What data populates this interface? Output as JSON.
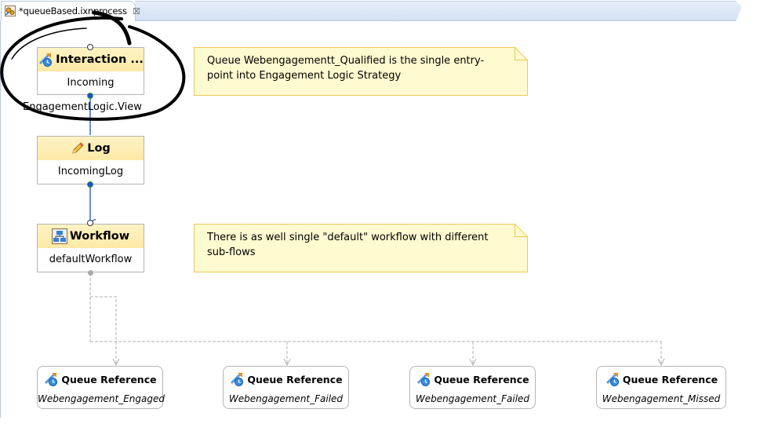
{
  "tab": {
    "icon": "process-file-icon",
    "title": "*queueBased.ixnprocess",
    "close_icon": "close-icon"
  },
  "nodes": {
    "interaction": {
      "icon": "interaction-queue-icon",
      "title": "Interaction ...",
      "name": "Incoming",
      "caption": "EngagementLogic.View"
    },
    "log": {
      "icon": "pencil-icon",
      "title": "Log",
      "name": "IncomingLog"
    },
    "workflow": {
      "icon": "workflow-icon",
      "title": "Workflow",
      "name": "defaultWorkflow"
    }
  },
  "notes": [
    {
      "text_line1": "Queue Webengagementt_Qualified is the single entry-",
      "text_line2": "point into Engagement Logic Strategy"
    },
    {
      "text_line1": "There is as well single \"default\" workflow with different",
      "text_line2": "sub-flows"
    }
  ],
  "queue_references": [
    {
      "icon": "queue-reference-icon",
      "title": "Queue Reference",
      "name": "Webengagement_Engaged"
    },
    {
      "icon": "queue-reference-icon",
      "title": "Queue Reference",
      "name": "Webengagement_Failed"
    },
    {
      "icon": "queue-reference-icon",
      "title": "Queue Reference",
      "name": "Webengagement_Failed"
    },
    {
      "icon": "queue-reference-icon",
      "title": "Queue Reference",
      "name": "Webengagement_Missed"
    }
  ],
  "annotation": {
    "shape": "hand-drawn-ellipse",
    "color": "#000000"
  },
  "colors": {
    "node_header": "#fde9a7",
    "note_fill": "#fffad0",
    "note_border": "#f2c85a",
    "connector": "#1a4ed8",
    "dashed_connector": "#b0b0b0"
  }
}
